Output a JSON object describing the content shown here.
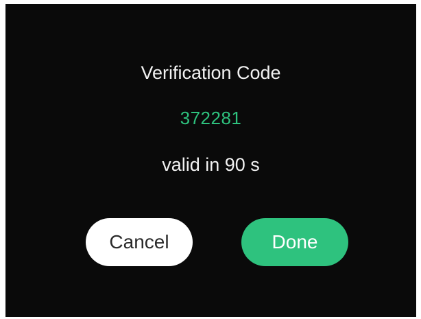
{
  "dialog": {
    "title": "Verification Code",
    "code": "372281",
    "validity": "valid in 90 s"
  },
  "buttons": {
    "cancel_label": "Cancel",
    "done_label": "Done"
  },
  "colors": {
    "accent": "#2ec27e",
    "background": "#0a0a0a",
    "text": "#f2f2f2"
  }
}
